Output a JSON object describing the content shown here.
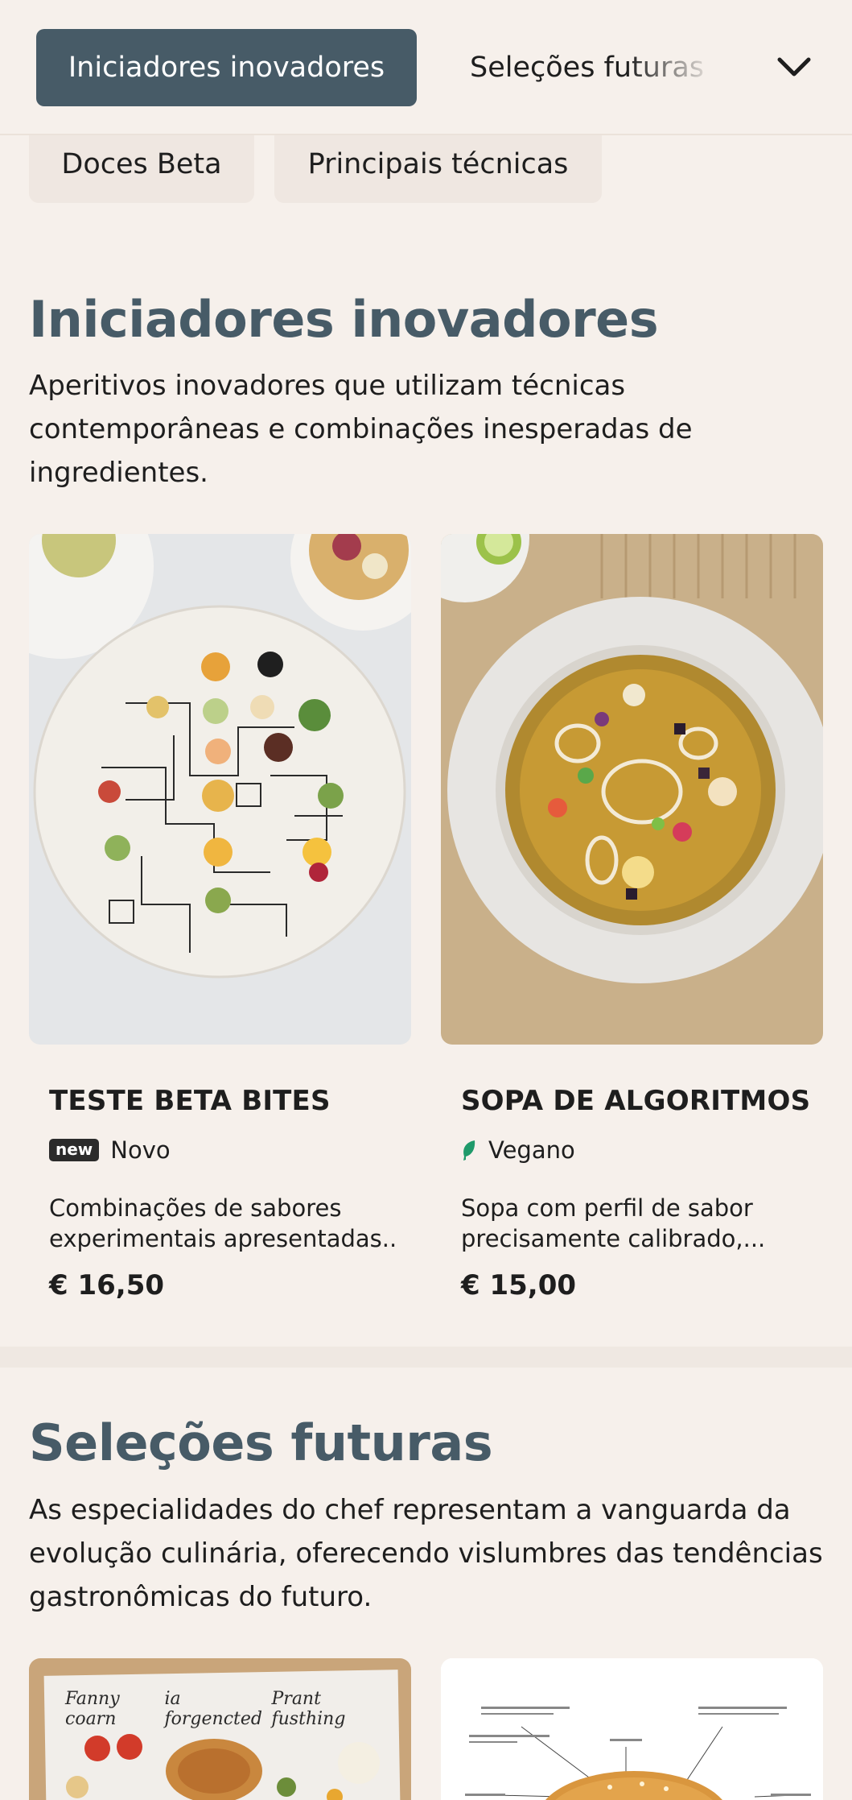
{
  "nav": {
    "active_tab": "Iniciadores inovadores",
    "next_tab": "Seleções futuras",
    "chevron_icon": "chevron-down-icon",
    "chips": [
      "Doces Beta",
      "Principais técnicas"
    ]
  },
  "sections": [
    {
      "title": "Iniciadores inovadores",
      "description_lines": [
        "Aperitivos inovadores que utilizam técnicas",
        "contemporâneas e combinações inesperadas de",
        "ingredientes."
      ],
      "items": [
        {
          "name": "TESTE BETA BITES",
          "badge": "new",
          "tag": "Novo",
          "desc_lines": [
            "Combinações de sabores",
            "experimentais apresentadas..."
          ],
          "price": "€ 16,50"
        },
        {
          "name": "SOPA DE ALGORITMOS",
          "tag_icon": "leaf-icon",
          "tag": "Vegano",
          "desc_lines": [
            "Sopa com perfil de sabor",
            "precisamente calibrado,..."
          ],
          "price": "€ 15,00"
        }
      ]
    },
    {
      "title": "Seleções futuras",
      "description_lines": [
        "As especialidades do chef representam a vanguarda da",
        "evolução culinária, oferecendo vislumbres das tendências",
        "gastronômicas do futuro."
      ],
      "items": [
        {
          "photo_caption": [
            "Fanny coarn",
            "ia forgencted",
            "Prant fusthing"
          ]
        },
        {}
      ]
    }
  ],
  "colors": {
    "background": "#f6f0eb",
    "accent": "#475b67",
    "vegan_leaf": "#1f9a6a"
  }
}
